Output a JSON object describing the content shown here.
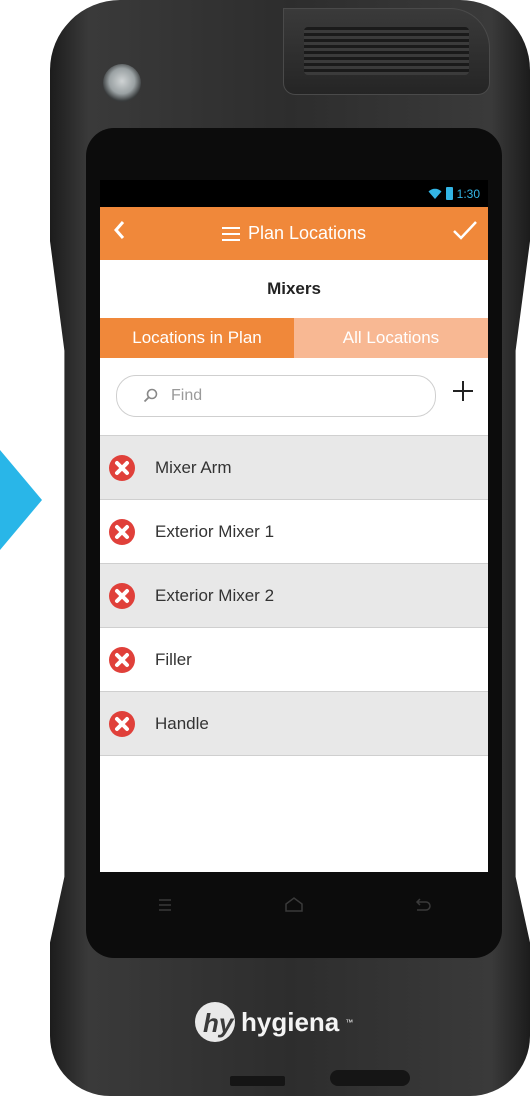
{
  "status_bar": {
    "time": "1:30"
  },
  "app_bar": {
    "title": "Plan Locations"
  },
  "subtitle": "Mixers",
  "tabs": [
    {
      "label": "Locations in Plan",
      "active": true
    },
    {
      "label": "All Locations",
      "active": false
    }
  ],
  "search": {
    "placeholder": "Find",
    "value": ""
  },
  "locations": [
    {
      "name": "Mixer Arm"
    },
    {
      "name": "Exterior Mixer 1"
    },
    {
      "name": "Exterior Mixer 2"
    },
    {
      "name": "Filler"
    },
    {
      "name": "Handle"
    }
  ],
  "brand": {
    "name": "hygiena",
    "trademark": "™"
  },
  "icons": {
    "back": "chevron-left-icon",
    "menu": "list-menu-icon",
    "confirm": "checkmark-icon",
    "search": "search-icon",
    "add": "plus-icon",
    "remove": "remove-circle-x-icon",
    "wifi": "wifi-icon",
    "battery": "battery-icon",
    "nav_menu": "menu-icon",
    "nav_home": "home-icon",
    "nav_back": "back-icon"
  },
  "colors": {
    "accent": "#f0883a",
    "tab_inactive": "#f8b893",
    "remove_icon": "#e0403a",
    "status_icons": "#33b5e5",
    "highlight_arrow": "#29b6e8"
  }
}
